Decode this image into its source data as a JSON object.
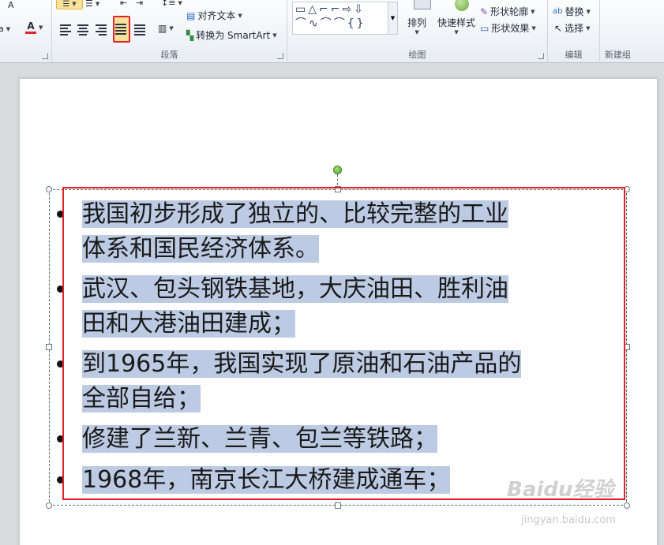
{
  "ribbon": {
    "groups": {
      "paragraph": {
        "label": "段落"
      },
      "drawing": {
        "label": "绘图"
      },
      "editing": {
        "label": "编辑"
      },
      "new_group": {
        "label": "新建组"
      }
    },
    "font_size_label": "A",
    "font_label": "a",
    "font_color_label": "A",
    "align_text_label": "对齐文本",
    "convert_smartart_label": "转换为 SmartArt",
    "arrange_label": "排列",
    "quick_styles_label": "快速样式",
    "shape_outline_label": "形状轮廓",
    "shape_effects_label": "形状效果",
    "replace_label": "替换",
    "select_label": "选择",
    "shape_glyphs_row1": "▭△⌐⌐⇨⇩",
    "shape_glyphs_row2": "⌒∿⌒⌒{}",
    "accent_color": "#e0232a"
  },
  "slide": {
    "paragraphs": [
      {
        "line1": "我国初步形成了独立的、比较完整的工业",
        "line2": "体系和国民经济体系。"
      },
      {
        "line1": "武汉、包头钢铁基地，大庆油田、胜利油",
        "line2": "田和大港油田建成；"
      },
      {
        "line1": "到1965年，我国实现了原油和石油产品的",
        "line2": "全部自给；"
      },
      {
        "line1": "修建了兰新、兰青、包兰等铁路；",
        "line2": ""
      },
      {
        "line1": "1968年，南京长江大桥建成通车；",
        "line2": ""
      }
    ],
    "selection_color": "#bccbe3"
  },
  "watermark": {
    "brand": "Baidu经验",
    "url": "jingyan.baidu.com"
  }
}
